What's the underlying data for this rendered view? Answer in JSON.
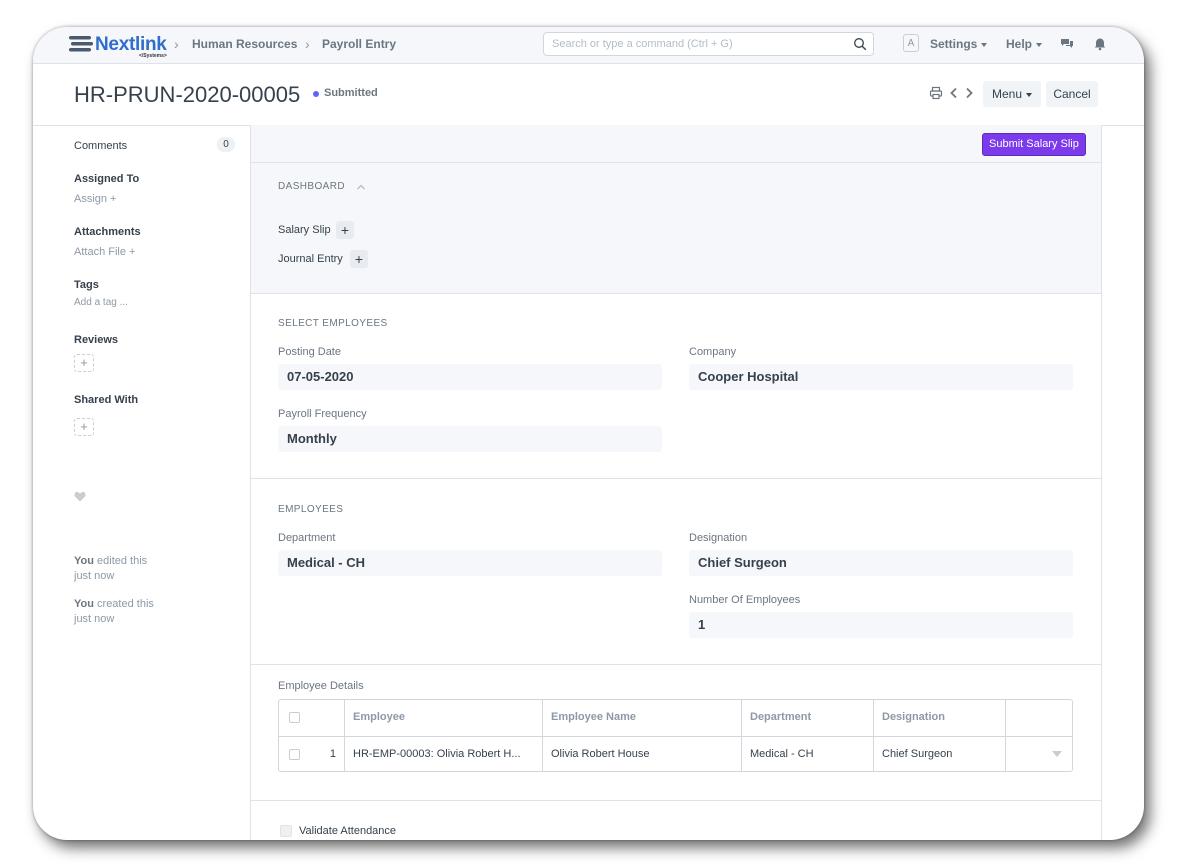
{
  "navbar": {
    "logo_text": "Nextlink",
    "logo_sub": "</Systems>",
    "breadcrumbs": [
      "Human Resources",
      "Payroll Entry"
    ],
    "search_placeholder": "Search or type a command (Ctrl + G)",
    "avatar_letter": "A",
    "settings_label": "Settings",
    "help_label": "Help"
  },
  "page": {
    "title": "HR-PRUN-2020-00005",
    "status": "Submitted",
    "status_color": "#5e64ff",
    "menu_label": "Menu",
    "cancel_label": "Cancel"
  },
  "sidebar": {
    "comments_label": "Comments",
    "comments_count": "0",
    "assigned_to_label": "Assigned To",
    "assign_link": "Assign",
    "attachments_label": "Attachments",
    "attach_link": "Attach File",
    "tags_label": "Tags",
    "tags_link": "Add a tag ...",
    "reviews_label": "Reviews",
    "shared_label": "Shared With",
    "activity": [
      {
        "who": "You",
        "action": "edited this",
        "when": "just now"
      },
      {
        "who": "You",
        "action": "created this",
        "when": "just now"
      }
    ]
  },
  "main": {
    "submit_salary_slip_label": "Submit Salary Slip",
    "primary_color": "#7c3aed",
    "dashboard": {
      "label": "DASHBOARD",
      "links": [
        "Salary Slip",
        "Journal Entry"
      ]
    },
    "select_employees": {
      "label": "SELECT EMPLOYEES",
      "posting_date_label": "Posting Date",
      "posting_date": "07-05-2020",
      "company_label": "Company",
      "company": "Cooper Hospital",
      "payroll_frequency_label": "Payroll Frequency",
      "payroll_frequency": "Monthly"
    },
    "employees": {
      "label": "EMPLOYEES",
      "department_label": "Department",
      "department": "Medical - CH",
      "designation_label": "Designation",
      "designation": "Chief Surgeon",
      "number_label": "Number Of Employees",
      "number": "1"
    },
    "employee_details": {
      "label": "Employee Details",
      "columns": [
        "Employee",
        "Employee Name",
        "Department",
        "Designation"
      ],
      "rows": [
        {
          "idx": "1",
          "employee": "HR-EMP-00003: Olivia Robert H...",
          "employee_name": "Olivia Robert House",
          "department": "Medical - CH",
          "designation": "Chief Surgeon"
        }
      ]
    },
    "validate_attendance_label": "Validate Attendance"
  }
}
